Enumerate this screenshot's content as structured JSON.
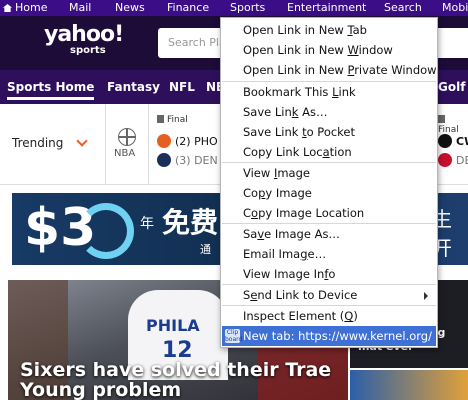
{
  "topnav": {
    "items": [
      "Home",
      "Mail",
      "News",
      "Finance",
      "Sports",
      "Entertainment",
      "Search",
      "Mobi"
    ]
  },
  "header": {
    "logo": "yahoo!",
    "logo_sub": "sports",
    "search_placeholder": "Search Pla"
  },
  "sportsnav": {
    "items": [
      "Sports Home",
      "Fantasy",
      "NFL",
      "NB",
      "Golf"
    ]
  },
  "scores": {
    "trending_label": "Trending",
    "league": "NBA",
    "game1": {
      "status": "Final",
      "team1": "(2) PHO",
      "team2": "(3) DEN"
    },
    "game2": {
      "status": "Final",
      "team1": "CW",
      "team2": "DEN"
    }
  },
  "ad": {
    "big_text": "$3",
    "cn1": "年",
    "cn2": "免费",
    "cn3": "生开",
    "small": "通"
  },
  "hero": {
    "headline": "Sixers have solved their Trae Young problem",
    "jersey_text": "PHILA",
    "jersey_number": "12"
  },
  "side_card": {
    "text": "basket boxing mat ever"
  },
  "context_menu": {
    "items": [
      {
        "pre": "Open Link in New ",
        "acc": "T",
        "post": "ab"
      },
      {
        "pre": "Open Link in New ",
        "acc": "W",
        "post": "indow"
      },
      {
        "pre": "Open Link in New ",
        "acc": "P",
        "post": "rivate Window"
      },
      {
        "pre": "Bookmark This ",
        "acc": "L",
        "post": "ink"
      },
      {
        "pre": "Save Lin",
        "acc": "k",
        "post": " As…"
      },
      {
        "pre": "Save Link ",
        "acc": "t",
        "post": "o Pocket"
      },
      {
        "pre": "Copy Link Loc",
        "acc": "a",
        "post": "tion"
      },
      {
        "pre": "View ",
        "acc": "I",
        "post": "mage"
      },
      {
        "pre": "Co",
        "acc": "p",
        "post": "y Image"
      },
      {
        "pre": "C",
        "acc": "o",
        "post": "py Image Location"
      },
      {
        "pre": "Sa",
        "acc": "v",
        "post": "e Image As…"
      },
      {
        "pre": "Email Ima",
        "acc": "g",
        "post": "e…"
      },
      {
        "pre": "View Image In",
        "acc": "f",
        "post": "o"
      },
      {
        "pre": "S",
        "acc": "e",
        "post": "nd Link to Device"
      },
      {
        "pre": "Inspect Element (",
        "acc": "Q",
        "post": ")"
      },
      {
        "pre": "New tab: https://www.kernel.org/",
        "acc": "",
        "post": ""
      }
    ],
    "clip_badge": "Clip board"
  }
}
